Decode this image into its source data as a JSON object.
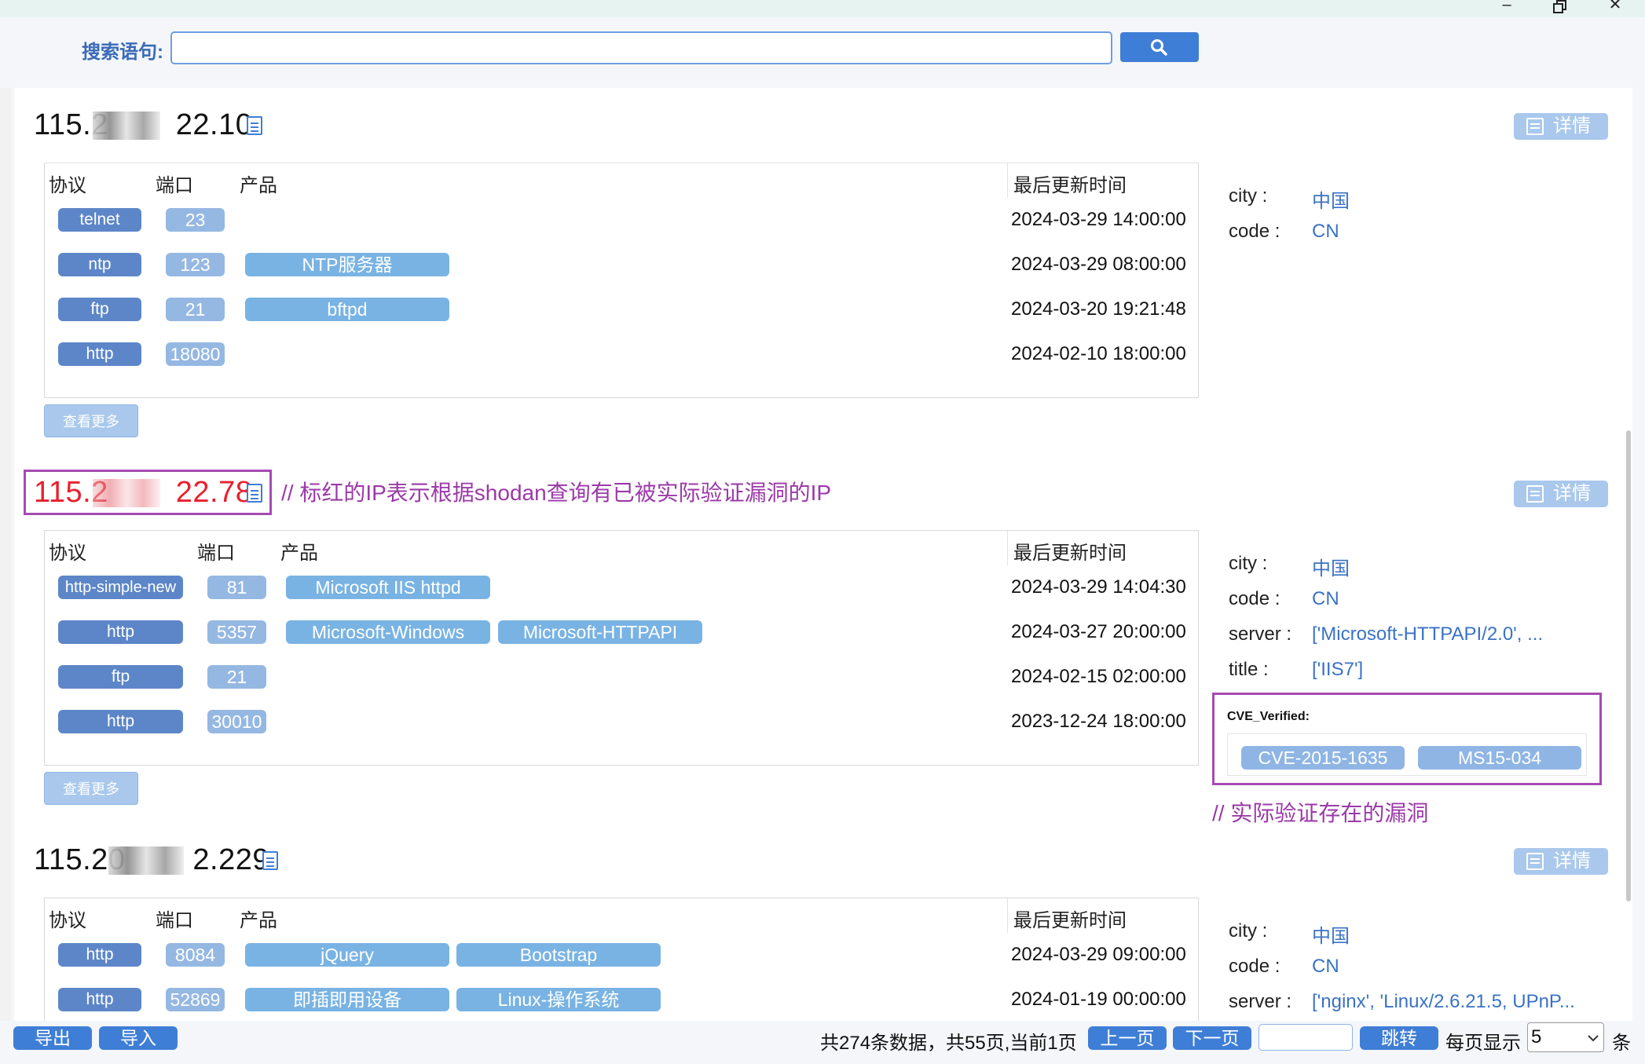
{
  "search": {
    "label": "搜索语句:",
    "value": ""
  },
  "common": {
    "detail_label": "详情",
    "more_label": "查看更多",
    "col_protocol": "协议",
    "col_port": "端口",
    "col_product": "产品",
    "col_updated": "最后更新时间"
  },
  "hosts": [
    {
      "ip_prefix": "115.2",
      "ip_suffix": "22.10",
      "highlighted": false,
      "services": [
        {
          "protocol": "telnet",
          "port": "23",
          "products": [],
          "updated": "2024-03-29 14:00:00"
        },
        {
          "protocol": "ntp",
          "port": "123",
          "products": [
            "NTP服务器"
          ],
          "updated": "2024-03-29 08:00:00"
        },
        {
          "protocol": "ftp",
          "port": "21",
          "products": [
            "bftpd"
          ],
          "updated": "2024-03-20 19:21:48"
        },
        {
          "protocol": "http",
          "port": "18080",
          "products": [],
          "updated": "2024-02-10 18:00:00"
        }
      ],
      "info": [
        {
          "key": "city :",
          "value": "中国"
        },
        {
          "key": "code :",
          "value": "CN"
        }
      ]
    },
    {
      "ip_prefix": "115.2",
      "ip_suffix": "22.78",
      "highlighted": true,
      "annotation": "// 标红的IP表示根据shodan查询有已被实际验证漏洞的IP",
      "services": [
        {
          "protocol": "http-simple-new",
          "port": "81",
          "products": [
            "Microsoft IIS httpd"
          ],
          "updated": "2024-03-29 14:04:30"
        },
        {
          "protocol": "http",
          "port": "5357",
          "products": [
            "Microsoft-Windows",
            "Microsoft-HTTPAPI"
          ],
          "updated": "2024-03-27 20:00:00"
        },
        {
          "protocol": "ftp",
          "port": "21",
          "products": [],
          "updated": "2024-02-15 02:00:00"
        },
        {
          "protocol": "http",
          "port": "30010",
          "products": [],
          "updated": "2023-12-24 18:00:00"
        }
      ],
      "info": [
        {
          "key": "city :",
          "value": "中国"
        },
        {
          "key": "code :",
          "value": "CN"
        },
        {
          "key": "server :",
          "value": "['Microsoft-HTTPAPI/2.0', ..."
        },
        {
          "key": "title :",
          "value": "['IIS7']"
        }
      ],
      "cve_title": "CVE_Verified:",
      "cves": [
        "CVE-2015-1635",
        "MS15-034"
      ],
      "cve_annotation": "// 实际验证存在的漏洞"
    },
    {
      "ip_prefix": "115.20",
      "ip_suffix": "2.229",
      "highlighted": false,
      "services": [
        {
          "protocol": "http",
          "port": "8084",
          "products": [
            "jQuery",
            "Bootstrap"
          ],
          "updated": "2024-03-29 09:00:00"
        },
        {
          "protocol": "http",
          "port": "52869",
          "products": [
            "即插即用设备",
            "Linux-操作系统"
          ],
          "updated": "2024-01-19 00:00:00"
        }
      ],
      "info": [
        {
          "key": "city :",
          "value": "中国"
        },
        {
          "key": "code :",
          "value": "CN"
        },
        {
          "key": "server :",
          "value": "['nginx', 'Linux/2.6.21.5, UPnP..."
        }
      ]
    }
  ],
  "footer": {
    "export_label": "导出",
    "import_label": "导入",
    "summary": "共274条数据，共55页,当前1页",
    "prev_label": "上一页",
    "next_label": "下一页",
    "jump_value": "",
    "jump_label": "跳转",
    "per_page_label": "每页显示",
    "per_page_value": "5",
    "unit": "条"
  },
  "colors": {
    "accent": "#3f7ed6",
    "highlight_red": "#e8202e",
    "annotation_purple": "#9b3aa8",
    "tag_blue": "#79b3e3"
  }
}
